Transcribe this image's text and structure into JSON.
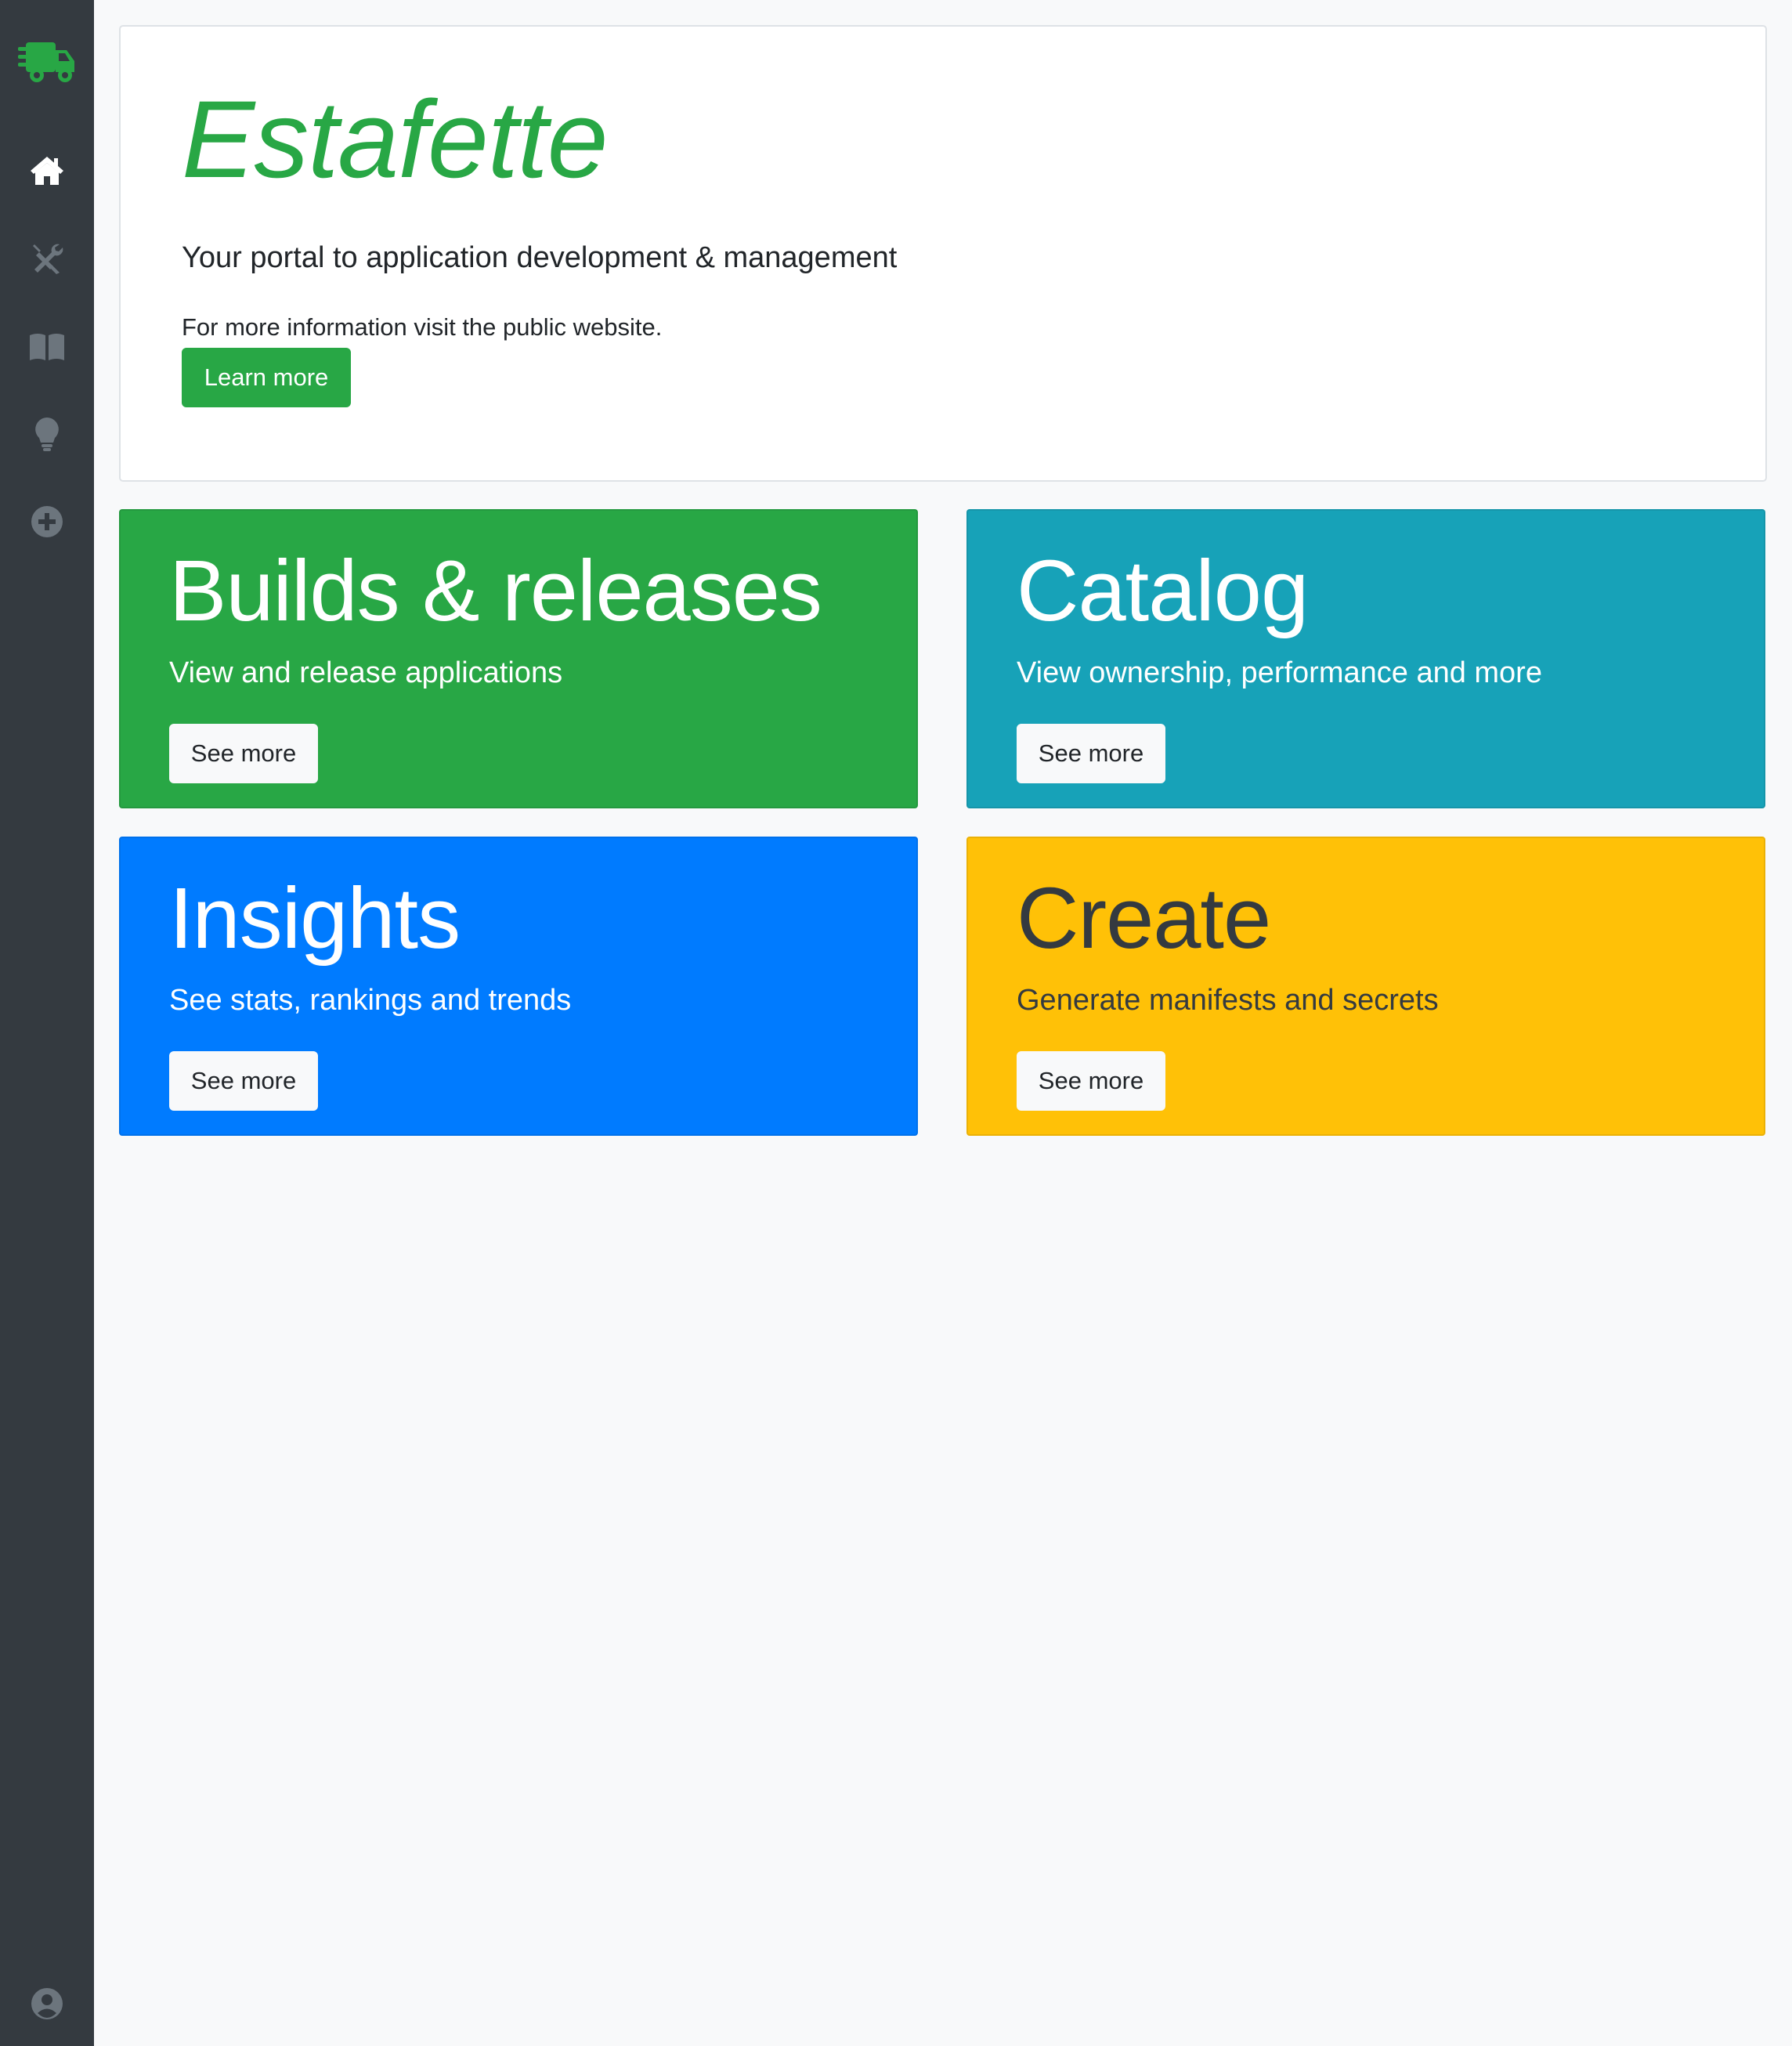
{
  "sidebar": {
    "background": "#343a40",
    "brand_icon": "truck-fast-icon",
    "brand_color": "#28a745",
    "items": [
      {
        "icon": "home-icon",
        "active": true
      },
      {
        "icon": "tools-icon",
        "active": false
      },
      {
        "icon": "book-icon",
        "active": false
      },
      {
        "icon": "lightbulb-icon",
        "active": false
      },
      {
        "icon": "plus-circle-icon",
        "active": false
      }
    ],
    "footer_icon": "user-circle-icon"
  },
  "jumbotron": {
    "title": "Estafette",
    "lead": "Your portal to application development & management",
    "info": "For more information visit the public website.",
    "button_label": "Learn more"
  },
  "cards": [
    {
      "title": "Builds & releases",
      "subtitle": "View and release applications",
      "button_label": "See more",
      "color": "#28a745"
    },
    {
      "title": "Catalog",
      "subtitle": "View ownership, performance and more",
      "button_label": "See more",
      "color": "#17a2b8"
    },
    {
      "title": "Insights",
      "subtitle": "See stats, rankings and trends",
      "button_label": "See more",
      "color": "#007bff"
    },
    {
      "title": "Create",
      "subtitle": "Generate manifests and secrets",
      "button_label": "See more",
      "color": "#ffc107"
    }
  ],
  "colors": {
    "accent": "#28a745",
    "page_background": "#f8f9fa"
  }
}
